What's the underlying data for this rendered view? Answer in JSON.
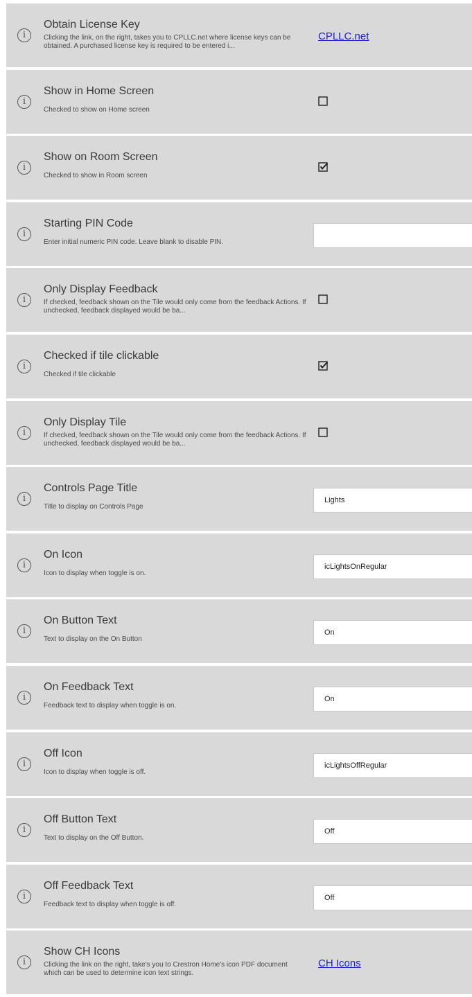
{
  "settings": [
    {
      "title": "Obtain License Key",
      "description": "Clicking the link, on the right, takes you to CPLLC.net where license keys can be obtained.  A purchased license key is required to be entered i...",
      "link": "CPLLC.net"
    },
    {
      "title": "Show in Home Screen",
      "description": "Checked to show on Home screen",
      "checked": false
    },
    {
      "title": "Show on Room Screen",
      "description": "Checked to show in Room screen",
      "checked": true
    },
    {
      "title": "Starting PIN Code",
      "description": "Enter initial numeric PIN code.  Leave blank to disable PIN.",
      "value": ""
    },
    {
      "title": "Only Display Feedback",
      "description": "If checked, feedback shown on the Tile would only come from the feedback Actions.  If unchecked, feedback displayed would be ba...",
      "checked": false
    },
    {
      "title": "Checked if tile clickable",
      "description": "Checked if tile clickable",
      "checked": true
    },
    {
      "title": "Only Display Tile",
      "description": "If checked, feedback shown on the Tile would only come from the feedback Actions.  If unchecked, feedback displayed would be ba...",
      "checked": false
    },
    {
      "title": "Controls Page Title",
      "description": "Title to display on Controls Page",
      "value": "Lights"
    },
    {
      "title": "On Icon",
      "description": "Icon to display when toggle is on.",
      "value": "icLightsOnRegular"
    },
    {
      "title": "On Button Text",
      "description": "Text to display on the On Button",
      "value": "On"
    },
    {
      "title": "On Feedback Text",
      "description": "Feedback text to display when toggle is on.",
      "value": "On"
    },
    {
      "title": "Off Icon",
      "description": "Icon to display when toggle is off.",
      "value": "icLightsOffRegular"
    },
    {
      "title": "Off Button Text",
      "description": "Text to display on the Off Button.",
      "value": "Off"
    },
    {
      "title": "Off Feedback Text",
      "description": "Feedback text to display when toggle is off.",
      "value": "Off"
    },
    {
      "title": "Show CH Icons",
      "description": "Clicking the link on the right, take's you to Crestron Home's icon PDF document which can be used to determine icon text strings.",
      "link": "CH Icons"
    }
  ],
  "icons": {
    "info": "info-circle-icon",
    "info_glyph": "i",
    "checkbox": "checkbox-icon"
  }
}
